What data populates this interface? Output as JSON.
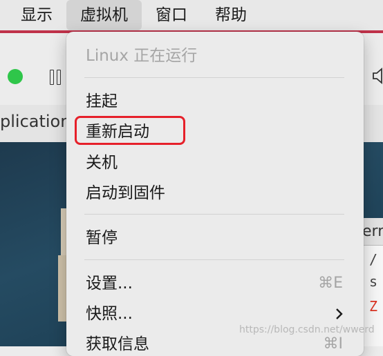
{
  "menubar": {
    "items": [
      "显示",
      "虚拟机",
      "窗口",
      "帮助"
    ],
    "active_index": 1
  },
  "background": {
    "tab_text": "plication",
    "terminal_title": "ern",
    "terminal_lines": [
      "/",
      "s",
      "Z"
    ]
  },
  "menu": {
    "status": "Linux 正在运行",
    "items": {
      "suspend": "挂起",
      "restart": "重新启动",
      "shutdown": "关机",
      "boot_firmware": "启动到固件",
      "pause": "暂停",
      "settings": "设置...",
      "settings_shortcut": "⌘E",
      "snapshots": "快照...",
      "get_info": "获取信息",
      "get_info_shortcut": "⌘I"
    }
  },
  "watermark": "https://blog.csdn.net/wwerd",
  "colors": {
    "highlight_border": "#e6202a",
    "green_dot": "#2fc64a"
  }
}
